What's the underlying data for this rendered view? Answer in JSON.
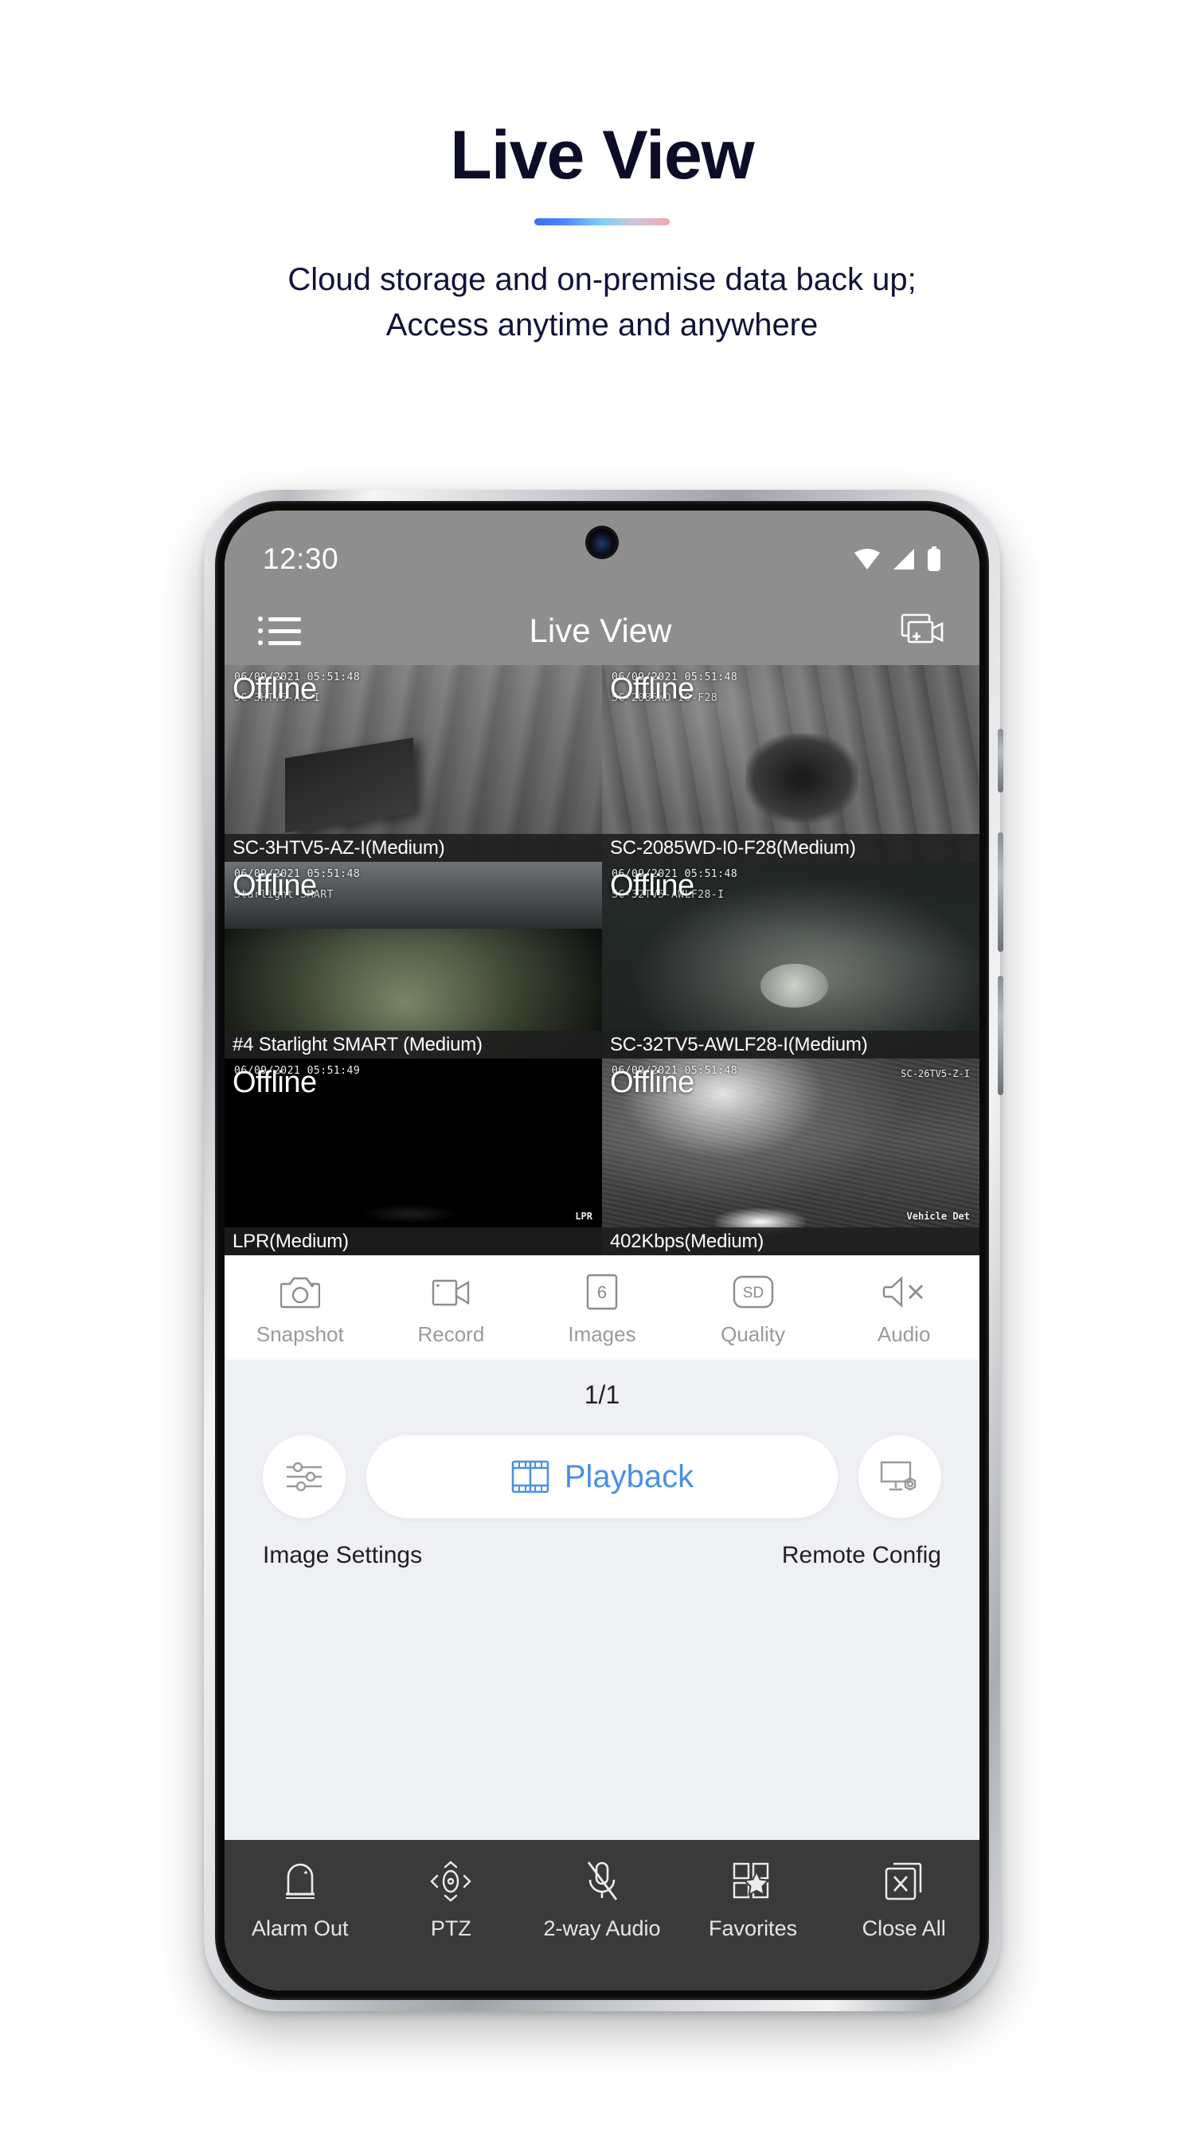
{
  "hero": {
    "title": "Live View",
    "subtitle_line1": "Cloud storage and on-premise data back up;",
    "subtitle_line2": "Access anytime and anywhere",
    "divider_gradient": [
      "#3b6ef5",
      "#7ed0f5",
      "#f4a7b2"
    ]
  },
  "phone": {
    "statusbar": {
      "time": "12:30",
      "icons": [
        "wifi-icon",
        "cellular-signal-icon",
        "battery-icon"
      ]
    },
    "appbar": {
      "menu_icon": "hamburger-list-icon",
      "title": "Live View",
      "action_icon": "add-camera-icon"
    },
    "grid": {
      "offline_label": "Offline",
      "cells": [
        {
          "name": "SC-3HTV5-AZ-I(Medium)",
          "timestamp": "06/09/2021 05:51:48",
          "overlay_id": "SC-3HTV5-AZ-I",
          "status": "Offline",
          "selected": false,
          "scene": "scene1"
        },
        {
          "name": "SC-2085WD-I0-F28(Medium)",
          "timestamp": "06/09/2021 05:51:48",
          "overlay_id": "SC-2085WD-I0-F28",
          "status": "Offline",
          "selected": false,
          "scene": "scene2"
        },
        {
          "name": "#4 Starlight SMART (Medium)",
          "timestamp": "06/09/2021 05:51:48",
          "overlay_id": "Starlight SMART",
          "status": "Offline",
          "selected": false,
          "scene": "scene3"
        },
        {
          "name": "SC-32TV5-AWLF28-I(Medium)",
          "timestamp": "06/09/2021 05:51:48",
          "overlay_id": "SC-32TV5-AWLF28-I",
          "status": "Offline",
          "selected": false,
          "scene": "scene4"
        },
        {
          "name": "LPR(Medium)",
          "timestamp": "06/09/2021 05:51:49",
          "overlay_id": "LPR",
          "status": "Offline",
          "selected": false,
          "scene": "scene5"
        },
        {
          "name": "402Kbps(Medium)",
          "timestamp": "06/09/2021 05:51:48",
          "overlay_id": "SC-26TV5-Z-I",
          "overlay_tag": "Vehicle Det",
          "status": "Offline",
          "selected": true,
          "scene": "scene6"
        }
      ],
      "selection_border_color": "#d8cc96"
    },
    "toolbar": [
      {
        "label": "Snapshot",
        "icon": "camera-icon"
      },
      {
        "label": "Record",
        "icon": "video-camera-icon"
      },
      {
        "label": "Images",
        "icon": "images-count-icon",
        "badge": "6"
      },
      {
        "label": "Quality",
        "icon": "quality-sd-icon",
        "badge": "SD"
      },
      {
        "label": "Audio",
        "icon": "audio-muted-icon"
      }
    ],
    "pager": "1/1",
    "playback": {
      "label": "Playback",
      "icon": "film-strip-icon",
      "accent_color": "#4a90e2",
      "left_icon": "sliders-icon",
      "right_icon": "remote-config-icon",
      "left_label": "Image Settings",
      "right_label": "Remote Config"
    },
    "bottomnav": [
      {
        "label": "Alarm Out",
        "icon": "alarm-siren-icon"
      },
      {
        "label": "PTZ",
        "icon": "ptz-directional-icon"
      },
      {
        "label": "2-way Audio",
        "icon": "mic-muted-icon"
      },
      {
        "label": "Favorites",
        "icon": "grid-star-icon"
      },
      {
        "label": "Close All",
        "icon": "close-all-icon"
      }
    ]
  }
}
